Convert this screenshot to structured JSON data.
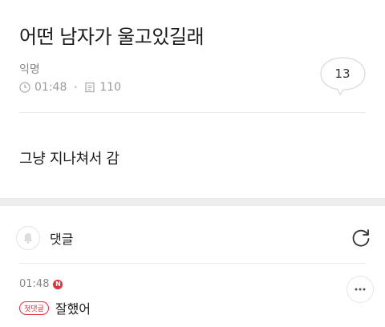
{
  "post": {
    "title": "어떤 남자가 울고있길래",
    "author": "익명",
    "time": "01:48",
    "views": "110",
    "comment_count": "13",
    "body": "그냥 지나쳐서 감"
  },
  "comments_section": {
    "header_label": "댓글",
    "items": [
      {
        "time": "01:48",
        "new_badge": "N",
        "first_badge": "첫댓글",
        "text": "잘했어"
      }
    ]
  },
  "icons": {
    "clock": "clock-icon",
    "views": "document-icon",
    "comment": "speech-bubble-icon",
    "bell": "bell-icon",
    "refresh": "refresh-icon",
    "more": "ellipsis-icon"
  },
  "colors": {
    "accent_red": "#e0313b",
    "muted_text": "#9a9a9a",
    "section_divider": "#ededed"
  }
}
